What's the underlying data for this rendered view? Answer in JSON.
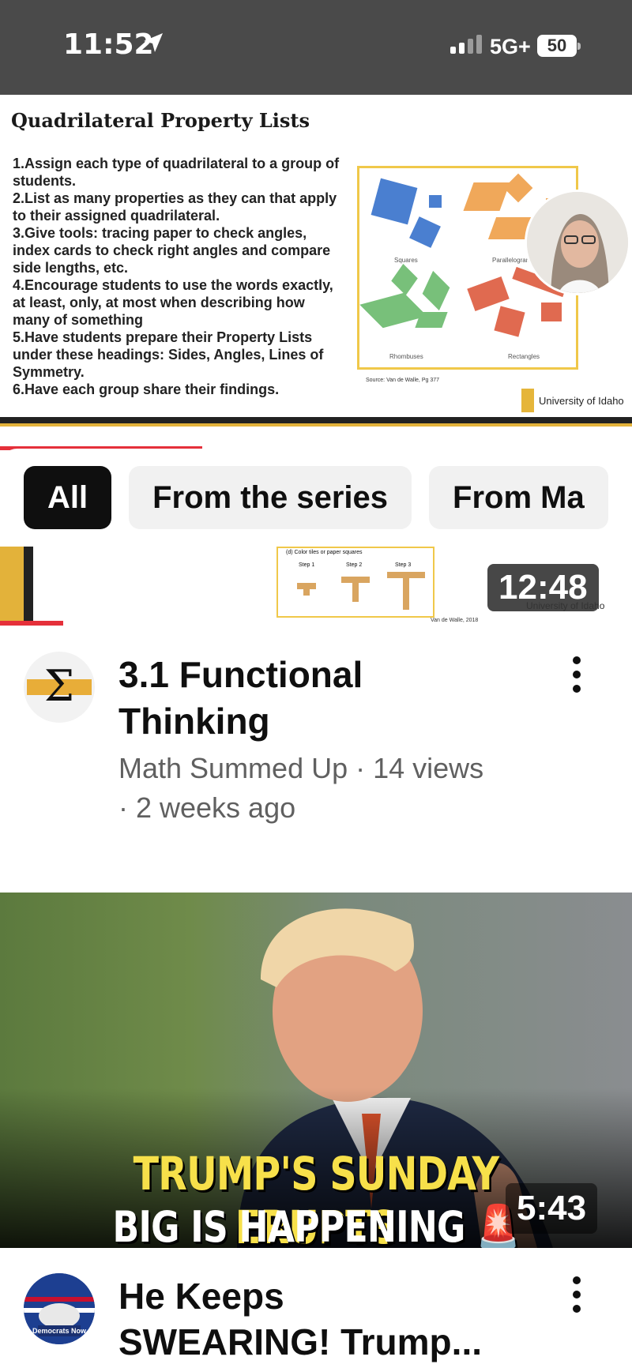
{
  "status_bar": {
    "time": "11:52",
    "network": "5G+",
    "battery": "50"
  },
  "player": {
    "slide_title": "Quadrilateral Property Lists",
    "slide_items": [
      "1.Assign each type of quadrilateral to a group of students.",
      "2.List as many properties as they can that apply to their assigned quadrilateral.",
      "3.Give tools: tracing paper to check angles, index cards to check right angles and compare side lengths, etc.",
      "4.Encourage students to use the words exactly, at least, only, at most when describing how many of something",
      "5.Have students prepare their Property Lists under these headings: Sides, Angles, Lines of Symmetry.",
      "6.Have each group share their findings."
    ],
    "shape_labels": [
      "Squares",
      "Parallelograms",
      "Rhombuses",
      "Rectangles"
    ],
    "source": "Source: Van de Walle, Pg 377",
    "university": "University of Idaho",
    "progress_fraction": 0.4
  },
  "chips": [
    {
      "label": "All",
      "active": true
    },
    {
      "label": "From the series",
      "active": false
    },
    {
      "label": "From Ma",
      "active": false
    }
  ],
  "videos": [
    {
      "duration": "12:48",
      "thumb_text": "(d) Color tiles or paper squares",
      "steps": [
        "Step 1",
        "Step 2",
        "Step 3"
      ],
      "watermark": "University of Idaho",
      "credit": "Van de Walle, 2018",
      "title_line1": "3.1 Functional",
      "title_line2": "Thinking",
      "meta_line1": "Math Summed Up · 14 views",
      "meta_line2": "· 2 weeks ago"
    },
    {
      "duration": "5:43",
      "headline1": "TRUMP'S SUNDAY ERUPTS",
      "headline2": "BIG IS HAPPENING 🚨",
      "channel_badge": "Democrats Now",
      "title_line1": "He Keeps",
      "title_line2": "SWEARING! Trump..."
    }
  ]
}
